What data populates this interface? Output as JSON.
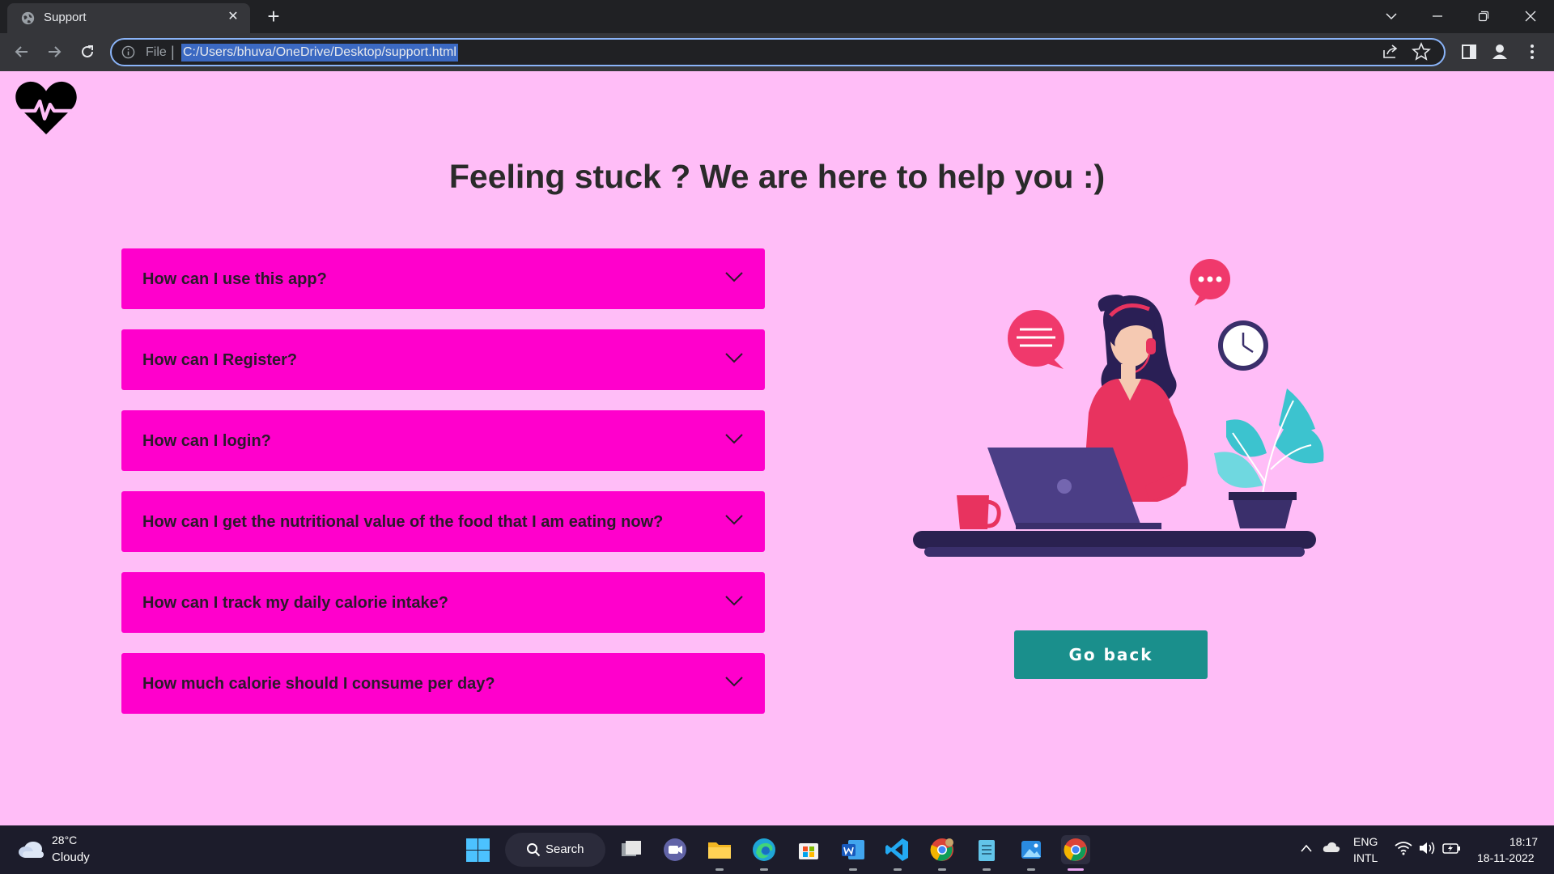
{
  "browser": {
    "tab_title": "Support",
    "tab_close": "✕",
    "new_tab": "+",
    "scheme_label": "File",
    "url": "C:/Users/bhuva/OneDrive/Desktop/support.html"
  },
  "page": {
    "headline": "Feeling stuck ? We are here to help you :)",
    "faq": [
      {
        "question": "How can I use this app?"
      },
      {
        "question": "How can I Register?"
      },
      {
        "question": "How can I login?"
      },
      {
        "question": "How can I get the nutritional value of the food that I am eating now?"
      },
      {
        "question": "How can I track my daily calorie intake?"
      },
      {
        "question": "How much calorie should I consume per day?"
      }
    ],
    "go_back_label": "Go back"
  },
  "taskbar": {
    "weather_temp": "28°C",
    "weather_desc": "Cloudy",
    "search_label": "Search",
    "language": "ENG",
    "layout": "INTL",
    "time": "18:17",
    "date": "18-11-2022"
  },
  "colors": {
    "page_bg": "#ffbdf7",
    "faq_bg": "#ff00cc",
    "button_bg": "#1a8f8c"
  }
}
